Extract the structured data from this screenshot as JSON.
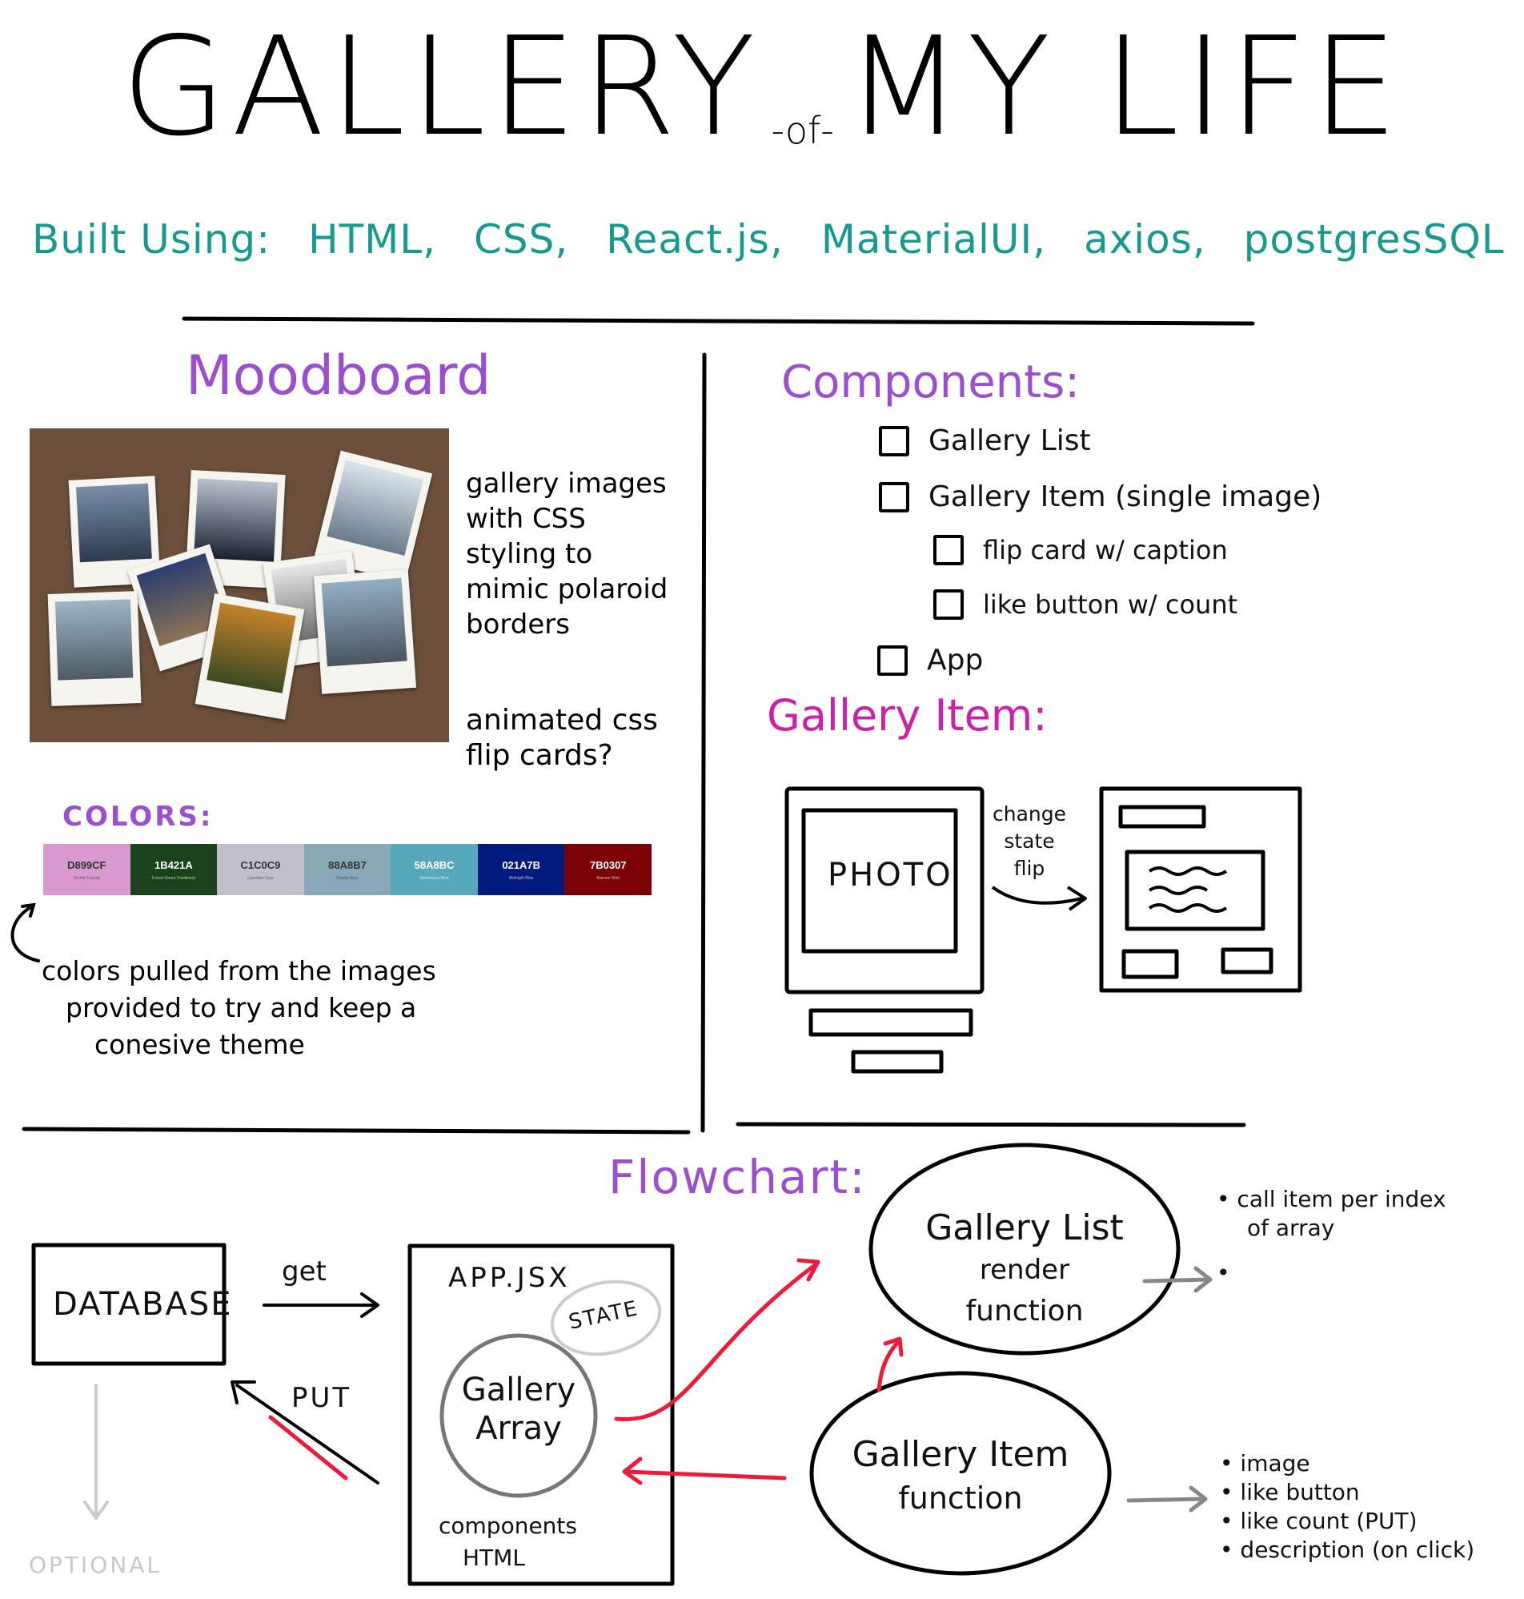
{
  "title": {
    "part1": "GALLERY",
    "part2": "-of-",
    "part3": "MY LIFE"
  },
  "built_using": {
    "label": "Built Using:",
    "items": [
      "HTML,",
      "CSS,",
      "React.js,",
      "MaterialUI,",
      "axios,",
      "postgresSQL"
    ]
  },
  "moodboard": {
    "title": "Moodboard",
    "note1": [
      "gallery images",
      "with CSS",
      "styling to",
      "mimic polaroid",
      "borders"
    ],
    "note2": [
      "animated css",
      "flip cards?"
    ],
    "colors_title": "COLORS:",
    "swatches": [
      {
        "hex": "D899CF",
        "name": "Orchid Crayola",
        "color": "#D899CF",
        "text": "#333"
      },
      {
        "hex": "1B421A",
        "name": "Forest Green Traditional",
        "color": "#1B421A",
        "text": "#fff"
      },
      {
        "hex": "C1C0C9",
        "name": "Lavender Gray",
        "color": "#C1C0C9",
        "text": "#333"
      },
      {
        "hex": "88A8B7",
        "name": "Pewter Blue",
        "color": "#88A8B7",
        "text": "#333"
      },
      {
        "hex": "58A8BC",
        "name": "Moonstone Blue",
        "color": "#58A8BC",
        "text": "#fff"
      },
      {
        "hex": "021A7B",
        "name": "Midnight Blue",
        "color": "#021A7B",
        "text": "#fff"
      },
      {
        "hex": "7B0307",
        "name": "Maroon Web",
        "color": "#7B0307",
        "text": "#fff"
      }
    ],
    "colors_note": [
      "colors pulled from the images",
      "provided to try and keep a",
      "conesive theme"
    ]
  },
  "components": {
    "title": "Components:",
    "items": [
      {
        "label": "Gallery List",
        "indent": 0
      },
      {
        "label": "Gallery Item (single image)",
        "indent": 0
      },
      {
        "label": "flip card w/ caption",
        "indent": 1
      },
      {
        "label": "like button w/ count",
        "indent": 1
      },
      {
        "label": "App",
        "indent": 0
      }
    ]
  },
  "gallery_item": {
    "title": "Gallery Item:",
    "photo_label": "PHOTO",
    "arrow_label": [
      "change",
      "state",
      "flip"
    ]
  },
  "flowchart": {
    "title": "Flowchart:",
    "database": "DATABASE",
    "get": "get",
    "put": "PUT",
    "optional": "OPTIONAL",
    "app_title": "APP.JSX",
    "state": "STATE",
    "gallery_array": [
      "Gallery",
      "Array"
    ],
    "components_html": [
      "components",
      "HTML"
    ],
    "list_node": [
      "Gallery List",
      "render",
      "function"
    ],
    "item_node": [
      "Gallery Item",
      "function"
    ],
    "list_bullets": [
      "call item per index",
      "of array",
      ""
    ],
    "item_bullets": [
      "image",
      "like button",
      "like count (PUT)",
      "description (on click)"
    ]
  }
}
